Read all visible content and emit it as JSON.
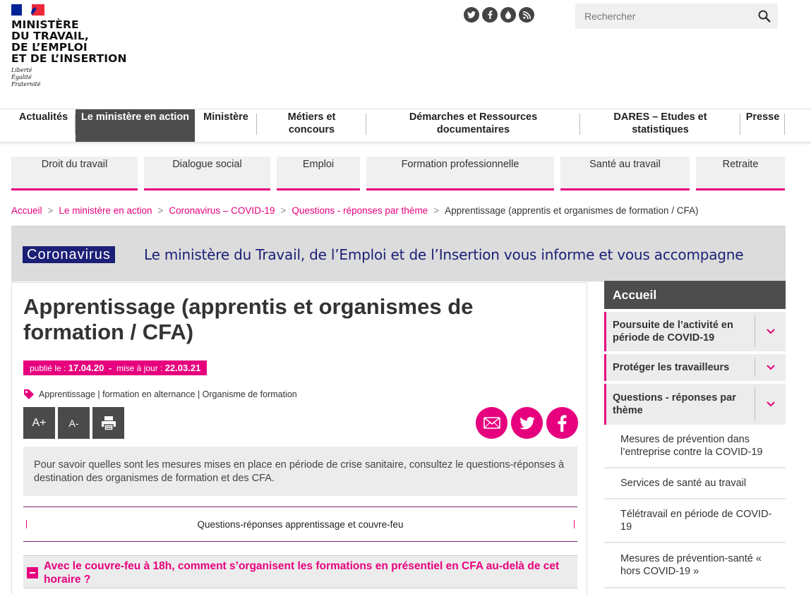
{
  "header": {
    "logo_lines": [
      "MINISTÈRE",
      "DU TRAVAIL,",
      "DE L’EMPLOI",
      "ET DE L’INSERTION"
    ],
    "motto": [
      "Liberté",
      "Égalité",
      "Fraternité"
    ],
    "social_icons": [
      "twitter-icon",
      "facebook-icon",
      "flickr-icon",
      "rss-icon"
    ],
    "search_placeholder": "Rechercher"
  },
  "mainnav": [
    {
      "label": "Actualités"
    },
    {
      "label": "Le ministère en action"
    },
    {
      "label": "Ministère"
    },
    {
      "label": "Métiers et concours"
    },
    {
      "label": "Démarches et Ressources documentaires"
    },
    {
      "label": "DARES – Etudes et statistiques"
    },
    {
      "label": "Presse"
    }
  ],
  "themes": [
    "Droit du travail",
    "Dialogue social",
    "Emploi",
    "Formation professionnelle",
    "Santé au travail",
    "Retraite"
  ],
  "breadcrumb": {
    "links": [
      "Accueil",
      "Le ministère en action",
      "Coronavirus – COVID-19",
      "Questions - réponses par thème"
    ],
    "current": "Apprentissage (apprentis et organismes de formation / CFA)",
    "separator": ">"
  },
  "banner": {
    "label": "Coronavirus",
    "text": "Le ministère du Travail, de l’Emploi et de l’Insertion vous informe et vous accompagne"
  },
  "article": {
    "title": "Apprentissage (apprentis et organismes de formation / CFA)",
    "published_label": "publié le",
    "published_date": "17.04.20",
    "updated_label": "mise à jour",
    "updated_date": "22.03.21",
    "tags": [
      "Apprentissage",
      "formation en alternance",
      "Organisme de formation"
    ],
    "font_increase": "A+",
    "font_decrease": "A-",
    "intro": "Pour savoir quelles sont les mesures mises en place en période de crise sanitaire, consultez le questions-réponses à destination des organismes de formation et des CFA.",
    "qr_link": "Questions-réponses apprentissage et couvre-feu",
    "question": "Avec le couvre-feu à 18h, comment s’organisent les formations en présentiel en CFA au-delà de cet horaire ?"
  },
  "sidebar": {
    "head": "Accueil",
    "items": [
      {
        "label": "Poursuite de l’activité en période de COVID-19"
      },
      {
        "label": "Protéger les travailleurs"
      },
      {
        "label": "Questions - réponses par thème"
      }
    ],
    "subitems": [
      "Mesures de prévention dans l’entreprise contre la COVID-19",
      "Services de santé au travail",
      "Télétravail en période de COVID-19",
      "Mesures de prévention-santé « hors COVID-19 »"
    ]
  },
  "colors": {
    "accent": "#e6007e",
    "dark": "#4d4d4d",
    "banner_blue": "#1b1f76"
  }
}
